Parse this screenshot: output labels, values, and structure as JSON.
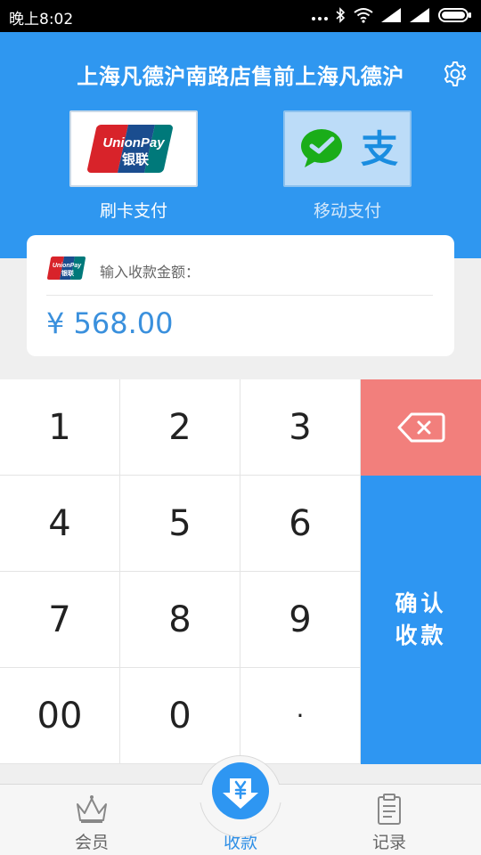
{
  "status_bar": {
    "time": "晚上8:02"
  },
  "header": {
    "store_name": "上海凡德沪南路店售前上海凡德沪",
    "pay_options": [
      {
        "label": "刷卡支付",
        "icon": "unionpay-logo-icon",
        "logo_text_en": "UnionPay",
        "logo_text_cn": "银联"
      },
      {
        "label": "移动支付",
        "icon": "wechat-alipay-icon",
        "logo_text_cn": "支"
      }
    ]
  },
  "amount": {
    "label": "输入收款金额：",
    "value": "¥ 568.00"
  },
  "keypad": {
    "keys": [
      "1",
      "2",
      "3",
      "4",
      "5",
      "6",
      "7",
      "8",
      "9",
      "00",
      "0",
      "·"
    ],
    "delete_icon": "backspace-icon",
    "confirm_line1": "确认",
    "confirm_line2": "收款"
  },
  "bottom_nav": {
    "items": [
      {
        "label": "会员",
        "icon": "crown-icon"
      },
      {
        "label": "收款",
        "icon": "yen-download-icon",
        "active": true
      },
      {
        "label": "记录",
        "icon": "clipboard-icon"
      }
    ]
  },
  "colors": {
    "primary": "#2f97f0",
    "delete": "#f27f7c",
    "amount_text": "#3a90dd"
  }
}
